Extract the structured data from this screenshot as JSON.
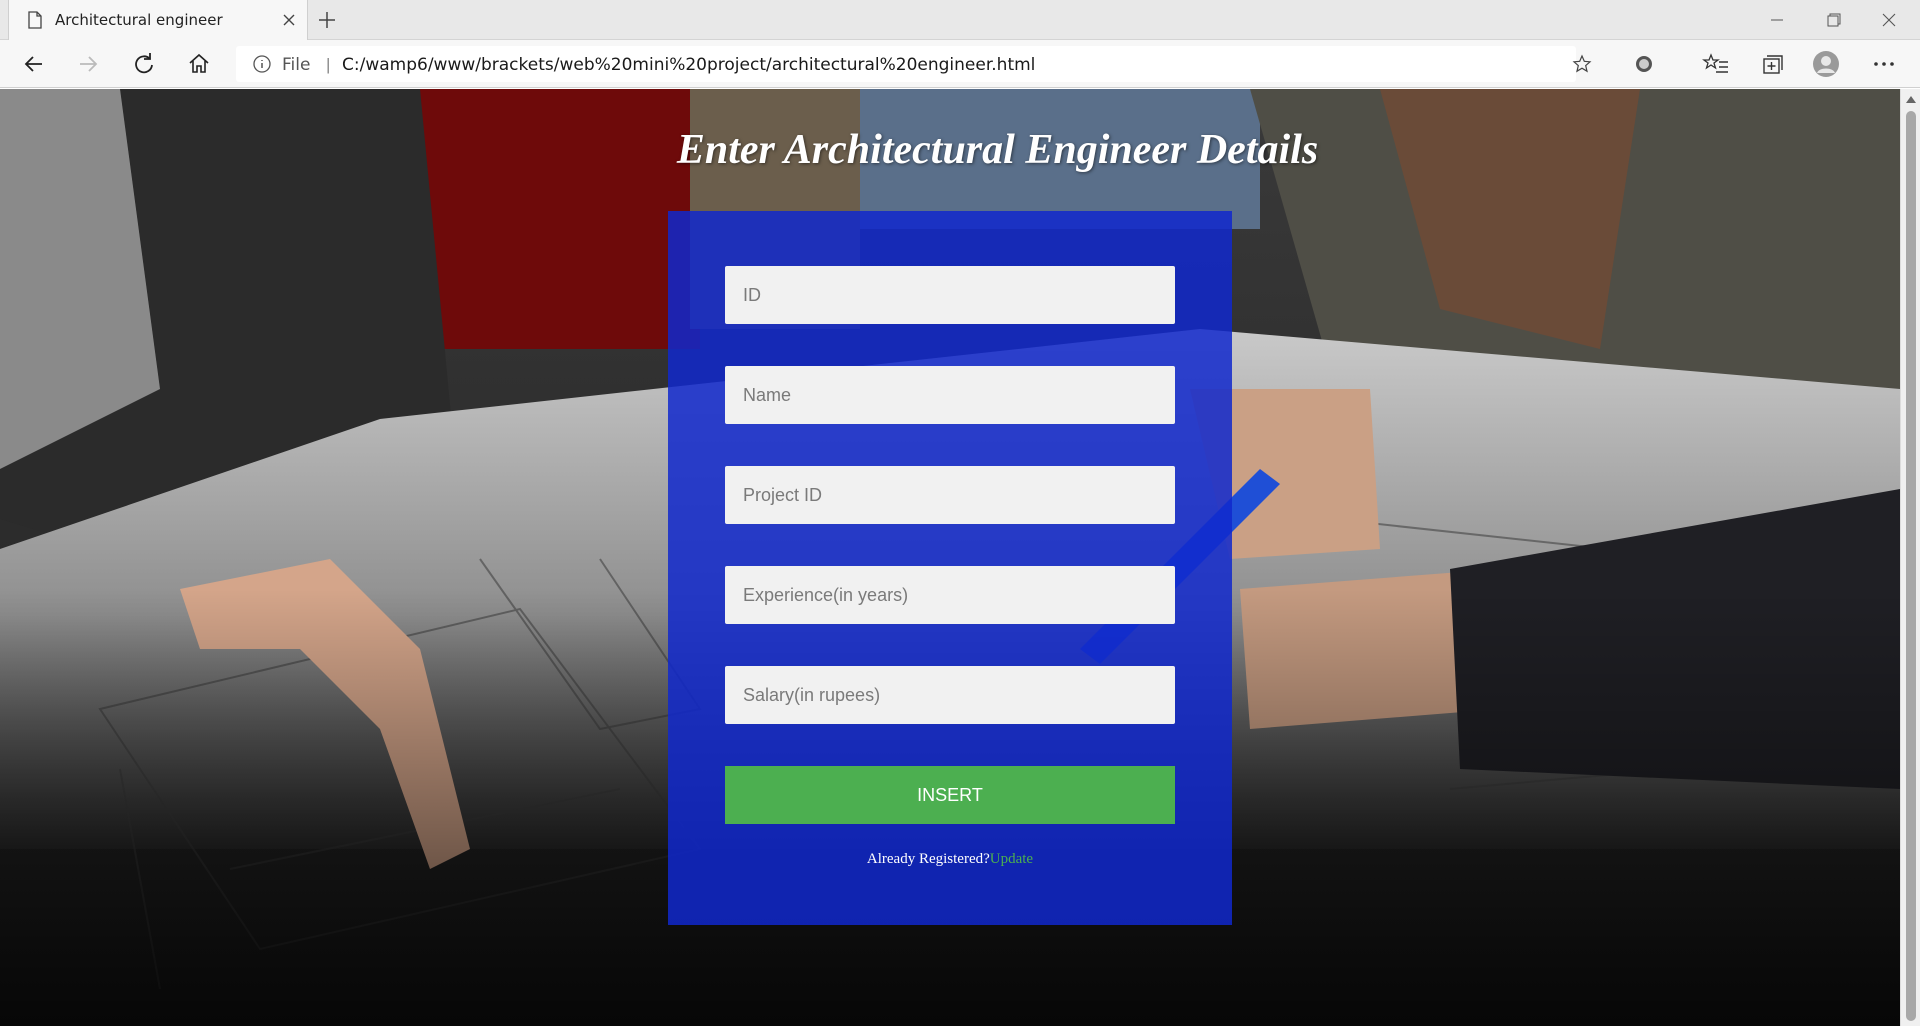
{
  "browser": {
    "tab_title": "Architectural engineer",
    "address_scheme": "File",
    "address_separator": "|",
    "url": "C:/wamp6/www/brackets/web%20mini%20project/architectural%20engineer.html"
  },
  "page": {
    "title": "Enter Architectural Engineer Details",
    "fields": {
      "id_placeholder": "ID",
      "name_placeholder": "Name",
      "project_id_placeholder": "Project ID",
      "experience_placeholder": "Experience(in years)",
      "salary_placeholder": "Salary(in rupees)"
    },
    "insert_label": "INSERT",
    "already_registered": "Already Registered?",
    "update_link": "Update"
  },
  "colors": {
    "panel": "#1028cd",
    "button": "#4caf50",
    "link": "#4caf50"
  },
  "icons": {
    "tab": "document-icon",
    "back": "arrow-left-icon",
    "forward": "arrow-right-icon",
    "refresh": "refresh-icon",
    "home": "home-icon",
    "info": "info-icon",
    "favorite": "star-icon",
    "collections": "collections-icon",
    "profile": "profile-icon",
    "more": "more-icon"
  }
}
